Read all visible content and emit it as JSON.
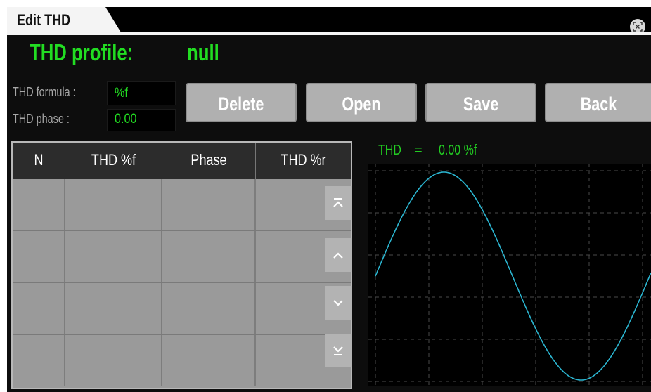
{
  "window": {
    "tab_title": "Edit THD",
    "close_icon": "close-icon"
  },
  "profile": {
    "label": "THD profile:",
    "value": "null"
  },
  "formula": {
    "label": "THD formula :",
    "value": "%f"
  },
  "phase": {
    "label": "THD phase :",
    "value": "0.00"
  },
  "buttons": {
    "delete": "Delete",
    "open": "Open",
    "save": "Save",
    "back": "Back"
  },
  "table": {
    "columns": [
      "N",
      "THD %f",
      "Phase",
      "THD %r"
    ],
    "rows": [
      [
        "",
        "",
        "",
        ""
      ],
      [
        "",
        "",
        "",
        ""
      ],
      [
        "",
        "",
        "",
        ""
      ],
      [
        "",
        "",
        "",
        ""
      ]
    ],
    "scroll_icons": [
      "scroll-top-icon",
      "scroll-up-icon",
      "scroll-down-icon",
      "scroll-bottom-icon"
    ]
  },
  "waveform": {
    "label": "THD",
    "equals": "=",
    "value": "0.00 %f",
    "trace_color": "#2bb5d0"
  },
  "colors": {
    "accent_green": "#22dd22",
    "button_gray": "#b0b0b0",
    "background": "#0d0d0d"
  }
}
